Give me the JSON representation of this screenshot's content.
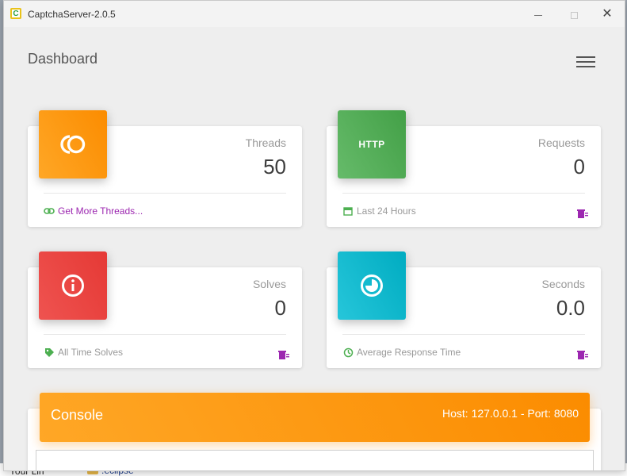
{
  "window": {
    "title": "CaptchaServer-2.0.5",
    "app_icon_letter": "C"
  },
  "page": {
    "title": "Dashboard"
  },
  "cards": {
    "threads": {
      "label": "Threads",
      "value": "50",
      "footer": "Get More Threads...",
      "icon": "co-icon",
      "color": "#fb8c00"
    },
    "requests": {
      "label": "Requests",
      "value": "0",
      "footer": "Last 24 Hours",
      "icon": "http-icon",
      "icon_text": "HTTP",
      "color": "#43a047"
    },
    "solves": {
      "label": "Solves",
      "value": "0",
      "footer": "All Time Solves",
      "icon": "info-icon",
      "color": "#e53935"
    },
    "seconds": {
      "label": "Seconds",
      "value": "0.0",
      "footer": "Average Response Time",
      "icon": "timer-icon",
      "color": "#00acc1"
    }
  },
  "console": {
    "title": "Console",
    "host_label": "Host: 127.0.0.1  -  Port: 8080"
  },
  "desktop": {
    "left_text": "Your Lin",
    "folder_text": ".eclipse"
  },
  "colors": {
    "link_purple": "#9c27b0",
    "footer_green": "#4caf50"
  }
}
